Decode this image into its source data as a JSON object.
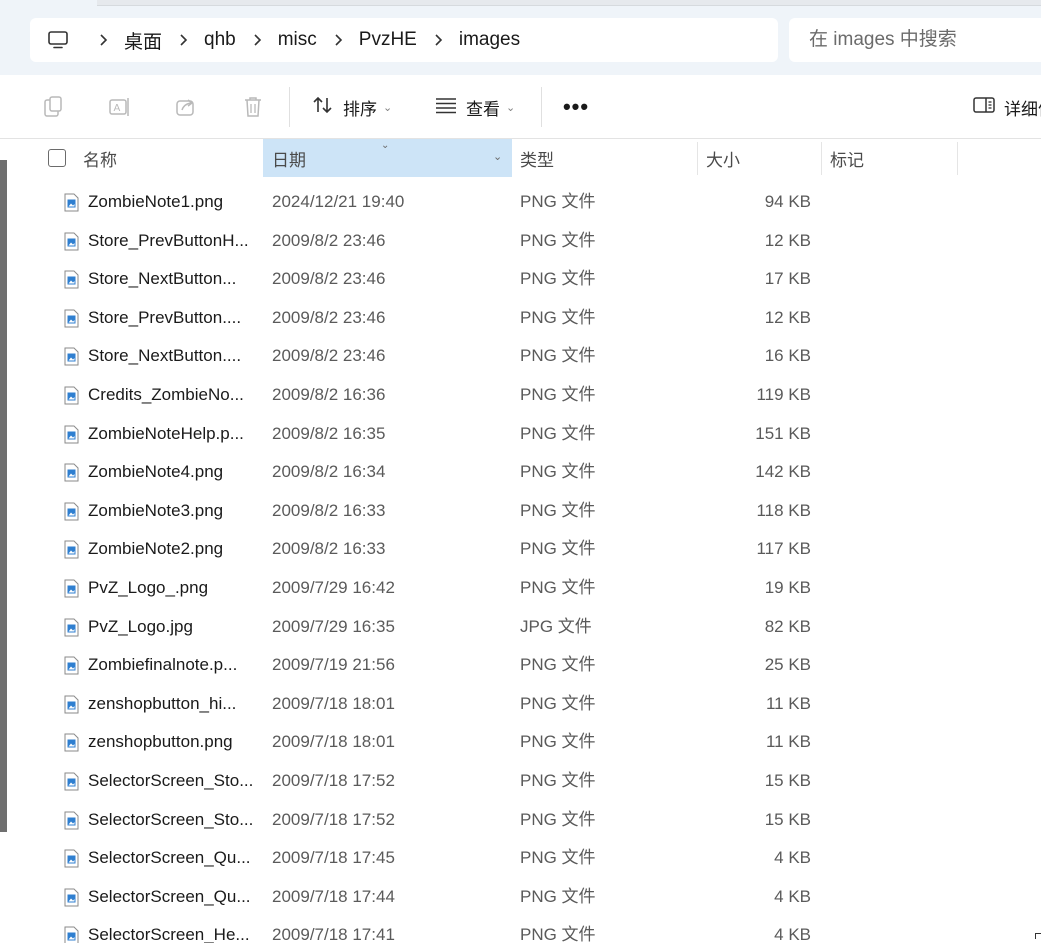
{
  "address_bar": {
    "root_icon": "computer-icon",
    "separator_icon": "chevron-right-icon",
    "crumbs": [
      "桌面",
      "qhb",
      "misc",
      "PvzHE",
      "images"
    ]
  },
  "search": {
    "placeholder": "在 images 中搜索"
  },
  "command_bar": {
    "icons": [
      "copy-icon",
      "rename-icon",
      "share-icon",
      "delete-icon"
    ],
    "sort_label": "排序",
    "view_label": "查看",
    "more_label": "•••",
    "details_label": "详细信息"
  },
  "columns": {
    "name": "名称",
    "date": "日期",
    "type": "类型",
    "size": "大小",
    "tags": "标记"
  },
  "files": [
    {
      "name": "ZombieNote1.png",
      "date": "2024/12/21 19:40",
      "type": "PNG 文件",
      "size": "94 KB"
    },
    {
      "name": "Store_PrevButtonH...",
      "date": "2009/8/2 23:46",
      "type": "PNG 文件",
      "size": "12 KB"
    },
    {
      "name": "Store_NextButton...",
      "date": "2009/8/2 23:46",
      "type": "PNG 文件",
      "size": "17 KB"
    },
    {
      "name": "Store_PrevButton....",
      "date": "2009/8/2 23:46",
      "type": "PNG 文件",
      "size": "12 KB"
    },
    {
      "name": "Store_NextButton....",
      "date": "2009/8/2 23:46",
      "type": "PNG 文件",
      "size": "16 KB"
    },
    {
      "name": "Credits_ZombieNo...",
      "date": "2009/8/2 16:36",
      "type": "PNG 文件",
      "size": "119 KB"
    },
    {
      "name": "ZombieNoteHelp.p...",
      "date": "2009/8/2 16:35",
      "type": "PNG 文件",
      "size": "151 KB"
    },
    {
      "name": "ZombieNote4.png",
      "date": "2009/8/2 16:34",
      "type": "PNG 文件",
      "size": "142 KB"
    },
    {
      "name": "ZombieNote3.png",
      "date": "2009/8/2 16:33",
      "type": "PNG 文件",
      "size": "118 KB"
    },
    {
      "name": "ZombieNote2.png",
      "date": "2009/8/2 16:33",
      "type": "PNG 文件",
      "size": "117 KB"
    },
    {
      "name": "PvZ_Logo_.png",
      "date": "2009/7/29 16:42",
      "type": "PNG 文件",
      "size": "19 KB"
    },
    {
      "name": "PvZ_Logo.jpg",
      "date": "2009/7/29 16:35",
      "type": "JPG 文件",
      "size": "82 KB"
    },
    {
      "name": "Zombiefinalnote.p...",
      "date": "2009/7/19 21:56",
      "type": "PNG 文件",
      "size": "25 KB"
    },
    {
      "name": "zenshopbutton_hi...",
      "date": "2009/7/18 18:01",
      "type": "PNG 文件",
      "size": "11 KB"
    },
    {
      "name": "zenshopbutton.png",
      "date": "2009/7/18 18:01",
      "type": "PNG 文件",
      "size": "11 KB"
    },
    {
      "name": "SelectorScreen_Sto...",
      "date": "2009/7/18 17:52",
      "type": "PNG 文件",
      "size": "15 KB"
    },
    {
      "name": "SelectorScreen_Sto...",
      "date": "2009/7/18 17:52",
      "type": "PNG 文件",
      "size": "15 KB"
    },
    {
      "name": "SelectorScreen_Qu...",
      "date": "2009/7/18 17:45",
      "type": "PNG 文件",
      "size": "4 KB"
    },
    {
      "name": "SelectorScreen_Qu...",
      "date": "2009/7/18 17:44",
      "type": "PNG 文件",
      "size": "4 KB"
    },
    {
      "name": "SelectorScreen_He...",
      "date": "2009/7/18 17:41",
      "type": "PNG 文件",
      "size": "4 KB"
    }
  ],
  "colors": {
    "accent": "#0067c0",
    "address_bg": "#eff4f9",
    "sorted_header_bg": "#cde4f7"
  }
}
